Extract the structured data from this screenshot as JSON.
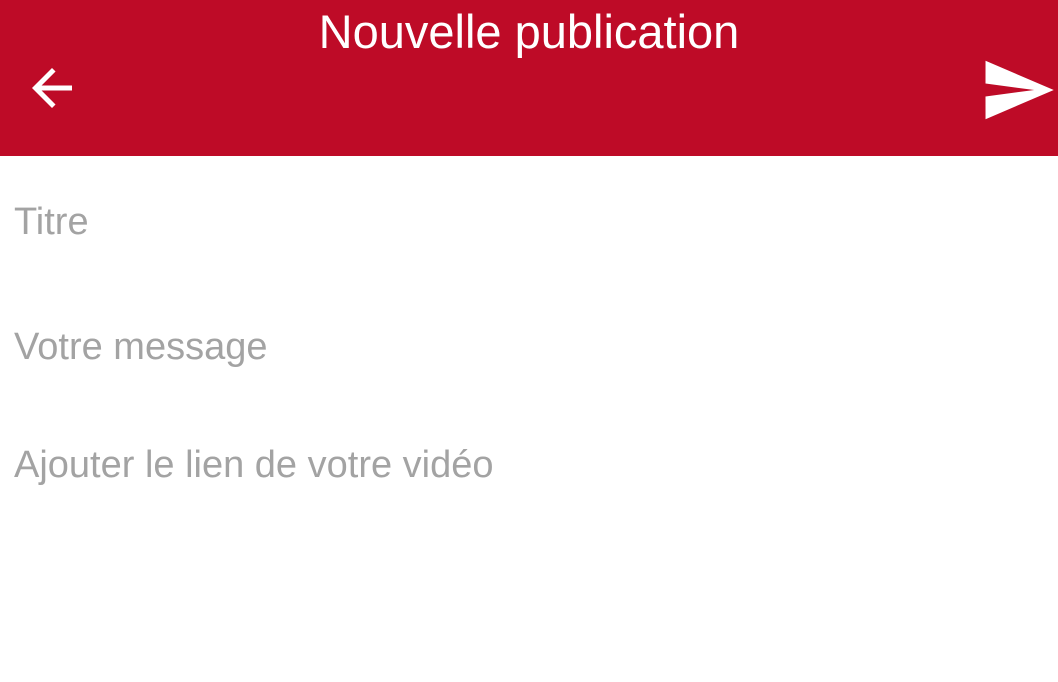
{
  "toolbar": {
    "title": "Nouvelle publication",
    "back_icon": "arrow-left-icon",
    "send_icon": "send-icon",
    "background_color": "#be0b27",
    "foreground_color": "#ffffff"
  },
  "form": {
    "title_field": {
      "value": "",
      "placeholder": "Titre"
    },
    "message_field": {
      "value": "",
      "placeholder": "Votre message"
    },
    "video_field": {
      "value": "",
      "placeholder": "Ajouter le lien de votre vidéo"
    },
    "placeholder_color": "#a3a3a3"
  }
}
